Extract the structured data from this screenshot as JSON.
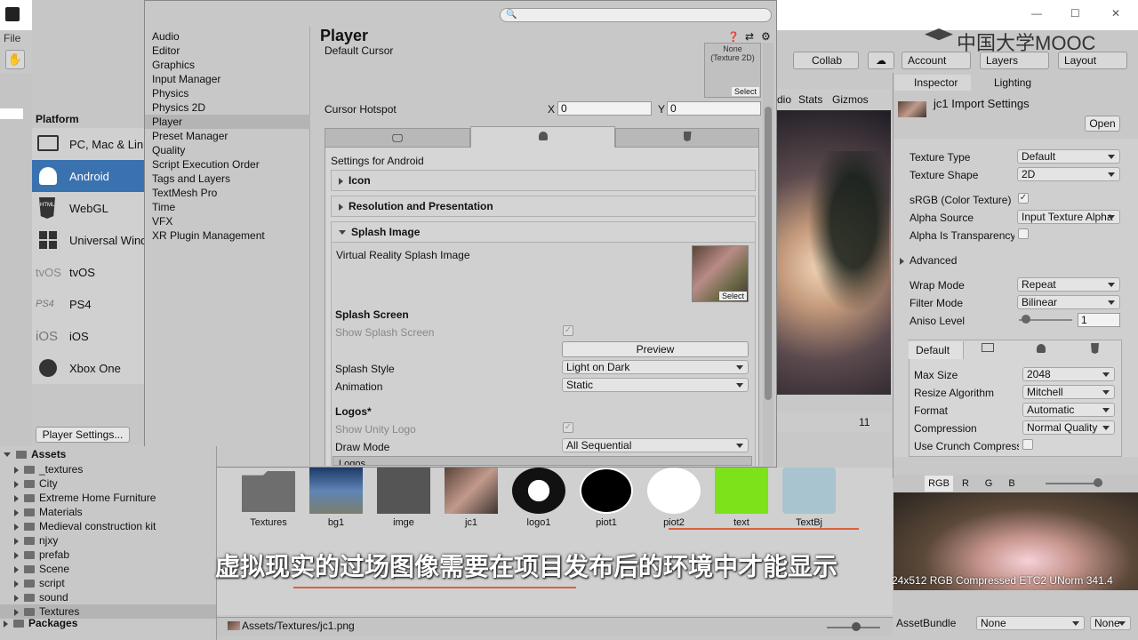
{
  "window": {
    "file_menu": "File",
    "minimize_glyph": "—",
    "maximize_glyph": "☐",
    "close_glyph": "✕"
  },
  "watermark": "中国大学MOOC",
  "toolbar": {
    "collab": "Collab",
    "account": "Account",
    "layers": "Layers",
    "layout": "Layout"
  },
  "build": {
    "platform_title": "Platform",
    "platforms": [
      {
        "label": "PC, Mac & Linux",
        "icon": "monitor-icon"
      },
      {
        "label": "Android",
        "icon": "android-icon"
      },
      {
        "label": "WebGL",
        "icon": "html5-icon"
      },
      {
        "label": "Universal Windows",
        "icon": "windows-icon"
      },
      {
        "label": "tvOS",
        "icon": "tvos-icon"
      },
      {
        "label": "PS4",
        "icon": "ps4-icon"
      },
      {
        "label": "iOS",
        "icon": "ios-icon"
      },
      {
        "label": "Xbox One",
        "icon": "xbox-icon"
      }
    ],
    "player_settings_button": "Player Settings...",
    "tvos_text": "tvOS",
    "ps4_text": "PS4",
    "ios_text": "iOS",
    "html_text": "HTML"
  },
  "project_settings": {
    "categories": [
      "Audio",
      "Editor",
      "Graphics",
      "Input Manager",
      "Physics",
      "Physics 2D",
      "Player",
      "Preset Manager",
      "Quality",
      "Script Execution Order",
      "Tags and Layers",
      "TextMesh Pro",
      "Time",
      "VFX",
      "XR Plugin Management"
    ],
    "selected": "Player"
  },
  "player": {
    "title": "Player",
    "default_cursor_label": "Default Cursor",
    "cursor_none": "None\n(Texture 2D)",
    "select": "Select",
    "cursor_hotspot_label": "Cursor Hotspot",
    "x_label": "X",
    "x_value": "0",
    "y_label": "Y",
    "y_value": "0",
    "settings_for": "Settings for Android",
    "sections": {
      "icon": "Icon",
      "resolution": "Resolution and Presentation",
      "splash": "Splash Image",
      "logos_bar": "Logos"
    },
    "vr_splash_label": "Virtual Reality Splash Image",
    "splash_screen_header": "Splash Screen",
    "show_splash_label": "Show Splash Screen",
    "preview_button": "Preview",
    "splash_style_label": "Splash Style",
    "splash_style_value": "Light on Dark",
    "animation_label": "Animation",
    "animation_value": "Static",
    "logos_header": "Logos*",
    "show_unity_logo_label": "Show Unity Logo",
    "draw_mode_label": "Draw Mode",
    "draw_mode_value": "All Sequential"
  },
  "scene_view": {
    "tab_partial": "dio",
    "stats": "Stats",
    "gizmos": "Gizmos",
    "hidden_count": "11"
  },
  "inspector": {
    "tab": "Inspector",
    "lighting_tab": "Lighting",
    "title": "jc1 Import Settings",
    "open_button": "Open",
    "rows": [
      {
        "label": "Texture Type",
        "value": "Default"
      },
      {
        "label": "Texture Shape",
        "value": "2D"
      }
    ],
    "srgb_label": "sRGB (Color Texture)",
    "alpha_source_label": "Alpha Source",
    "alpha_source_value": "Input Texture Alpha",
    "alpha_transparency_label": "Alpha Is Transparency",
    "advanced_label": "Advanced",
    "wrap_label": "Wrap Mode",
    "wrap_value": "Repeat",
    "filter_label": "Filter Mode",
    "filter_value": "Bilinear",
    "aniso_label": "Aniso Level",
    "aniso_value": "1",
    "aniso_fraction": 0.05,
    "default_tab": "Default",
    "max_size_label": "Max Size",
    "max_size_value": "2048",
    "resize_label": "Resize Algorithm",
    "resize_value": "Mitchell",
    "format_label": "Format",
    "format_value": "Automatic",
    "compression_label": "Compression",
    "compression_value": "Normal Quality",
    "crunch_label": "Use Crunch Compression",
    "channels": [
      "RGB",
      "R",
      "G",
      "B"
    ],
    "preview_info": "24x512  RGB Compressed ETC2 UNorm   341.4",
    "asset_bundle_label": "AssetBundle",
    "asset_bundle_value": "None",
    "asset_bundle_variant": "None"
  },
  "project": {
    "assets_header": "Assets",
    "packages_header": "Packages",
    "folders": [
      "_textures",
      "City",
      "Extreme Home Furniture",
      "Materials",
      "Medieval construction kit",
      "njxy",
      "prefab",
      "Scene",
      "script",
      "sound",
      "Textures"
    ],
    "selected_folder": "Textures",
    "grid_items": [
      "Textures",
      "bg1",
      "imge",
      "jc1",
      "logo1",
      "piot1",
      "piot2",
      "text",
      "TextBj"
    ],
    "path": "Assets/Textures/jc1.png"
  },
  "subtitle": "虚拟现实的过场图像需要在项目发布后的环境中才能显示",
  "colors": {
    "selected_blue": "#3a72b0",
    "subtitle_underline": "#e0603a"
  }
}
